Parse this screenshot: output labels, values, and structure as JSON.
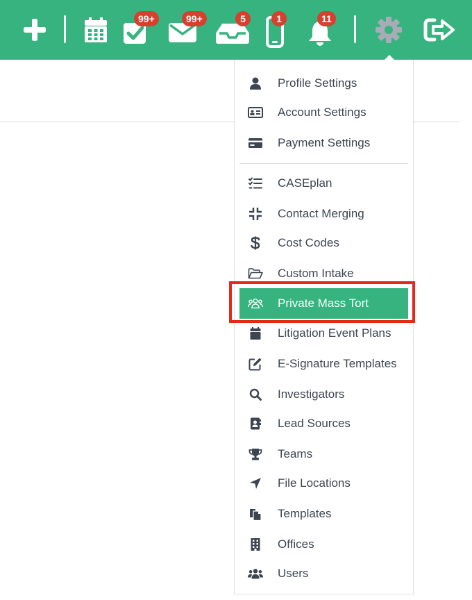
{
  "topbar": {
    "background": "#36b37e",
    "badge_color": "#d6402f",
    "buttons": [
      {
        "icon": "plus-icon"
      },
      {
        "icon": "calendar-icon"
      },
      {
        "icon": "task-check-icon",
        "badge": "99+"
      },
      {
        "icon": "envelope-icon",
        "badge": "99+"
      },
      {
        "icon": "inbox-tray-icon",
        "badge": "5"
      },
      {
        "icon": "mobile-phone-icon",
        "badge": "1"
      },
      {
        "icon": "bell-icon",
        "badge": "11"
      },
      {
        "icon": "gear-icon"
      },
      {
        "icon": "sign-out-icon"
      }
    ]
  },
  "settings_menu": {
    "highlight_color": "#e8271b",
    "active_color": "#36b37e",
    "items": [
      {
        "label": "Profile Settings",
        "icon": "user-icon"
      },
      {
        "label": "Account Settings",
        "icon": "id-card-icon"
      },
      {
        "label": "Payment Settings",
        "icon": "credit-card-icon"
      },
      {
        "label": "CASEplan",
        "icon": "checklist-icon"
      },
      {
        "label": "Contact Merging",
        "icon": "compress-icon"
      },
      {
        "label": "Cost Codes",
        "icon": "dollar-icon"
      },
      {
        "label": "Custom Intake",
        "icon": "folder-open-icon"
      },
      {
        "label": "Private Mass Tort",
        "icon": "users-outline-icon",
        "active": true
      },
      {
        "label": "Litigation Event Plans",
        "icon": "calendar-icon"
      },
      {
        "label": "E-Signature Templates",
        "icon": "edit-icon"
      },
      {
        "label": "Investigators",
        "icon": "magnifier-icon"
      },
      {
        "label": "Lead Sources",
        "icon": "address-book-icon"
      },
      {
        "label": "Teams",
        "icon": "trophy-icon"
      },
      {
        "label": "File Locations",
        "icon": "location-arrow-icon"
      },
      {
        "label": "Templates",
        "icon": "copy-files-icon"
      },
      {
        "label": "Offices",
        "icon": "building-icon"
      },
      {
        "label": "Users",
        "icon": "users-icon"
      }
    ]
  }
}
